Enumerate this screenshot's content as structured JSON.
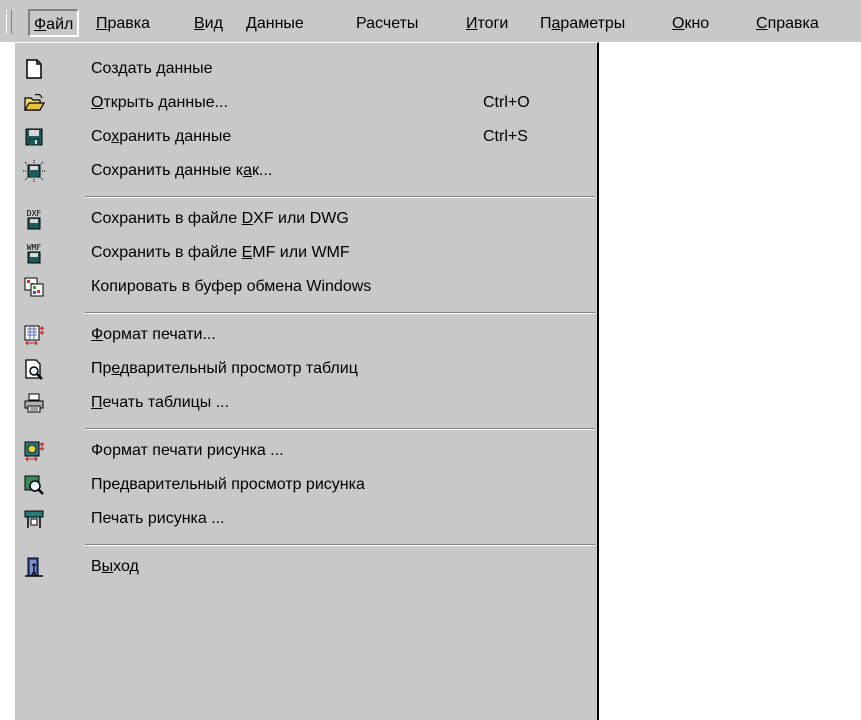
{
  "menubar": {
    "items": [
      {
        "pre": "",
        "ul": "Ф",
        "post": "айл"
      },
      {
        "pre": "",
        "ul": "П",
        "post": "равка"
      },
      {
        "pre": "",
        "ul": "В",
        "post": "ид"
      },
      {
        "pre": "",
        "ul": "Д",
        "post": "анные"
      },
      {
        "pre": "Расчеты",
        "ul": "",
        "post": ""
      },
      {
        "pre": "",
        "ul": "И",
        "post": "тоги"
      },
      {
        "pre": "П",
        "ul": "а",
        "post": "раметры"
      },
      {
        "pre": "",
        "ul": "О",
        "post": "кно"
      },
      {
        "pre": "",
        "ul": "С",
        "post": "правка"
      }
    ]
  },
  "menu": {
    "items": [
      {
        "icon": "new-document-icon",
        "pre": "Создать данные",
        "ul": "",
        "post": "",
        "shortcut": ""
      },
      {
        "icon": "open-folder-icon",
        "pre": "",
        "ul": "О",
        "post": "ткрыть данные...",
        "shortcut": "Ctrl+O"
      },
      {
        "icon": "floppy-save-icon",
        "pre": "Со",
        "ul": "х",
        "post": "ранить данные",
        "shortcut": "Ctrl+S"
      },
      {
        "icon": "floppy-save-as-icon",
        "pre": "Сохранить данные к",
        "ul": "а",
        "post": "к...",
        "shortcut": ""
      },
      {
        "icon": "dxf-save-icon",
        "icon_text": "DXF",
        "pre": "Сохранить в файле ",
        "ul": "D",
        "post": "XF или DWG",
        "shortcut": ""
      },
      {
        "icon": "wmf-save-icon",
        "icon_text": "WMF",
        "pre": "Сохранить в файле ",
        "ul": "E",
        "post": "MF или WMF",
        "shortcut": ""
      },
      {
        "icon": "clipboard-copy-icon",
        "pre": "Копировать в буфер обмена Windows",
        "ul": "",
        "post": "",
        "shortcut": ""
      },
      {
        "icon": "page-format-icon",
        "pre": "",
        "ul": "Ф",
        "post": "ормат печати...",
        "shortcut": ""
      },
      {
        "icon": "print-preview-table-icon",
        "pre": "Пр",
        "ul": "е",
        "post": "дварительный просмотр таблиц",
        "shortcut": ""
      },
      {
        "icon": "printer-icon",
        "pre": "",
        "ul": "П",
        "post": "ечать таблицы ...",
        "shortcut": ""
      },
      {
        "icon": "picture-format-icon",
        "pre": "Формат печати рисунка ...",
        "ul": "",
        "post": "",
        "shortcut": ""
      },
      {
        "icon": "picture-preview-icon",
        "pre": "Предварительный просмотр рисунка",
        "ul": "",
        "post": "",
        "shortcut": ""
      },
      {
        "icon": "picture-print-icon",
        "pre": "Печать рисунка ...",
        "ul": "",
        "post": "",
        "shortcut": ""
      },
      {
        "icon": "exit-icon",
        "pre": "В",
        "ul": "ы",
        "post": "ход",
        "shortcut": ""
      }
    ]
  }
}
